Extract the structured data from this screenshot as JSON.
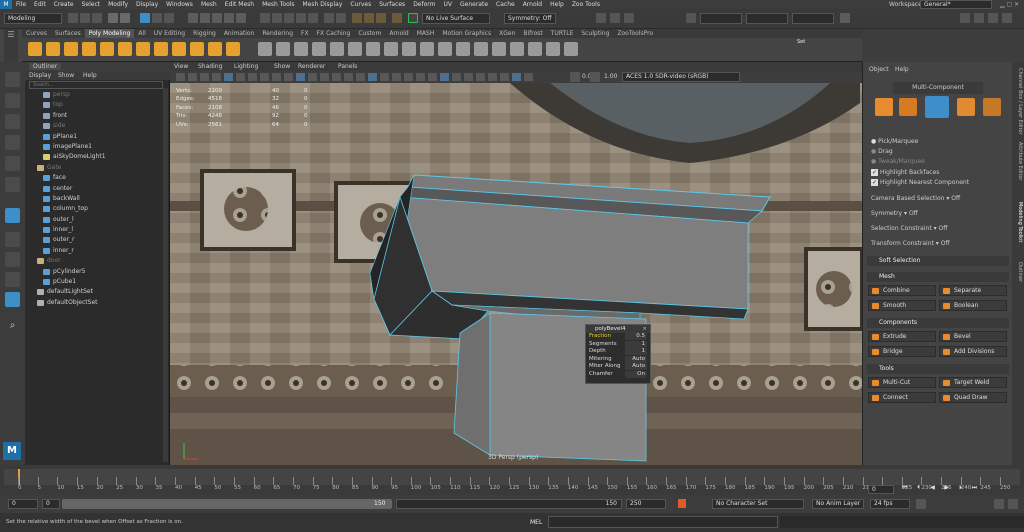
{
  "menubar": {
    "logo": "M",
    "items": [
      "File",
      "Edit",
      "Create",
      "Select",
      "Modify",
      "Display",
      "Windows",
      "Mesh",
      "Edit Mesh",
      "Mesh Tools",
      "Mesh Display",
      "Curves",
      "Surfaces",
      "Deform",
      "UV",
      "Generate",
      "Cache",
      "Arnold",
      "Help",
      "Zoo Tools"
    ],
    "workspace_label": "Workspace:",
    "workspace_value": "General*"
  },
  "status": {
    "mode": "Modeling",
    "live_surface": "No Live Surface",
    "symmetry": "Symmetry: Off",
    "set_label": "Set"
  },
  "shelf": {
    "tabs": [
      "Curves",
      "Surfaces",
      "Poly Modeling",
      "All",
      "UV Editing",
      "Rigging",
      "Animation",
      "Rendering",
      "FX",
      "FX Caching",
      "Custom",
      "Arnold",
      "MASH",
      "Motion Graphics",
      "XGen",
      "Bifrost",
      "TURTLE",
      "Sculpting",
      "ZooToolsPro"
    ],
    "active_tab": "Poly Modeling",
    "icon_colors": [
      "#e6a02e",
      "#e6a02e",
      "#e6a02e",
      "#e6a02e",
      "#e6a02e",
      "#e6a02e",
      "#e6a02e",
      "#e6a02e",
      "#e6a02e",
      "#e6a02e",
      "#e6a02e",
      "#e6a02e",
      "#9a9a9a",
      "#9a9a9a",
      "#9a9a9a",
      "#9a9a9a",
      "#9a9a9a",
      "#9a9a9a",
      "#9a9a9a",
      "#9a9a9a",
      "#9a9a9a",
      "#9a9a9a",
      "#9a9a9a",
      "#9a9a9a",
      "#9a9a9a",
      "#9a9a9a",
      "#9a9a9a",
      "#9a9a9a",
      "#9a9a9a",
      "#9a9a9a"
    ]
  },
  "outliner": {
    "title": "Outliner",
    "menu": [
      "Display",
      "Show",
      "Help"
    ],
    "search_placeholder": "Search...",
    "items": [
      {
        "name": "persp",
        "dim": true,
        "icon": "camera-icon"
      },
      {
        "name": "top",
        "dim": true,
        "icon": "camera-icon"
      },
      {
        "name": "front",
        "dim": false,
        "icon": "camera-icon"
      },
      {
        "name": "side",
        "dim": true,
        "icon": "camera-icon"
      },
      {
        "name": "pPlane1",
        "dim": false,
        "icon": "mesh-icon"
      },
      {
        "name": "imagePlane1",
        "dim": false,
        "icon": "mesh-icon"
      },
      {
        "name": "aiSkyDomeLight1",
        "dim": false,
        "icon": "light-icon"
      },
      {
        "name": "Gate",
        "dim": true,
        "icon": "group-icon"
      },
      {
        "name": "face",
        "dim": false,
        "icon": "mesh-icon"
      },
      {
        "name": "center",
        "dim": false,
        "icon": "mesh-icon"
      },
      {
        "name": "backWall",
        "dim": false,
        "icon": "mesh-icon"
      },
      {
        "name": "column_top",
        "dim": false,
        "icon": "mesh-icon"
      },
      {
        "name": "outer_l",
        "dim": false,
        "icon": "mesh-icon"
      },
      {
        "name": "inner_l",
        "dim": false,
        "icon": "mesh-icon"
      },
      {
        "name": "outer_r",
        "dim": false,
        "icon": "mesh-icon"
      },
      {
        "name": "inner_r",
        "dim": false,
        "icon": "mesh-icon"
      },
      {
        "name": "door",
        "dim": true,
        "icon": "group-icon"
      },
      {
        "name": "pCylinder5",
        "dim": false,
        "icon": "mesh-icon"
      },
      {
        "name": "pCube1",
        "dim": false,
        "icon": "mesh-icon"
      },
      {
        "name": "defaultLightSet",
        "dim": false,
        "icon": "set-icon"
      },
      {
        "name": "defaultObjectSet",
        "dim": false,
        "icon": "set-icon"
      }
    ]
  },
  "viewport": {
    "menu": [
      "View",
      "Shading",
      "Lighting",
      "Show",
      "Renderer",
      "Panels"
    ],
    "color_space": "ACES 1.0 SDR-video (sRGB)",
    "value_a": "0.00",
    "value_b": "1.00",
    "camera_label": "3D Persp (persp)",
    "hud": [
      {
        "label": "Verts:",
        "a": "2209",
        "b": "40",
        "c": "0"
      },
      {
        "label": "Edges:",
        "a": "4518",
        "b": "32",
        "c": "0"
      },
      {
        "label": "Faces:",
        "a": "2108",
        "b": "46",
        "c": "0"
      },
      {
        "label": "Tris:",
        "a": "4248",
        "b": "92",
        "c": "0"
      },
      {
        "label": "UVs:",
        "a": "2561",
        "b": "64",
        "c": "0"
      }
    ],
    "bevel": {
      "title": "polyBevel4",
      "rows": [
        {
          "label": "Fraction",
          "value": "0.5",
          "highlight": true
        },
        {
          "label": "Segments",
          "value": "1",
          "highlight": false
        },
        {
          "label": "Depth",
          "value": "1",
          "highlight": false
        },
        {
          "label": "Mitering",
          "value": "Auto",
          "highlight": false
        },
        {
          "label": "Miter Along",
          "value": "Auto",
          "highlight": false
        },
        {
          "label": "Chamfer",
          "value": "On",
          "highlight": false
        }
      ]
    }
  },
  "modeling_toolkit": {
    "menu": [
      "Object",
      "Help"
    ],
    "mode_label": "Multi-Component",
    "radio_options": [
      "Pick/Marquee",
      "Drag",
      "Tweak/Marquee"
    ],
    "checks": [
      "Highlight Backfaces",
      "Highlight Nearest Component"
    ],
    "camera_based": "Camera Based Selection",
    "camera_based_value": "Off",
    "symmetry": "Symmetry",
    "symmetry_value": "Off",
    "selection_constraint": "Selection Constraint",
    "selection_constraint_value": "Off",
    "transform_constraint": "Transform Constraint",
    "transform_constraint_value": "Off",
    "soft_selection": "Soft Selection",
    "sections": {
      "mesh": "Mesh",
      "components": "Components",
      "tools": "Tools"
    },
    "mesh_buttons": [
      "Combine",
      "Separate",
      "Smooth",
      "Boolean"
    ],
    "component_buttons": [
      "Extrude",
      "Bevel",
      "Bridge",
      "Add Divisions"
    ],
    "tool_buttons": [
      "Multi-Cut",
      "Target Weld",
      "Connect",
      "Quad Draw"
    ]
  },
  "side_tabs": [
    "Channel Box / Layer Editor",
    "Attribute Editor",
    "Modeling Toolkit",
    "Outliner"
  ],
  "timeline": {
    "ticks": [
      "0",
      "5",
      "10",
      "15",
      "20",
      "25",
      "30",
      "35",
      "40",
      "45",
      "50",
      "55",
      "60",
      "65",
      "70",
      "75",
      "80",
      "85",
      "90",
      "95",
      "100",
      "105",
      "110",
      "115",
      "120",
      "125",
      "130",
      "135",
      "140",
      "145",
      "150",
      "155",
      "160",
      "165",
      "170",
      "175",
      "180",
      "185",
      "190",
      "195",
      "200",
      "205",
      "210",
      "215",
      "220",
      "225",
      "230",
      "235",
      "240",
      "245",
      "250"
    ],
    "current_frame": "0",
    "range_start": "0",
    "range_inner_start": "0",
    "range_inner_end": "150",
    "range_end": "250",
    "character_set": "No Character Set",
    "anim_layer": "No Anim Layer",
    "fps": "24 fps"
  },
  "cmdline": {
    "help_text": "Set the relative width of the bevel when Offset as Fraction is on.",
    "lang": "MEL"
  },
  "colors": {
    "accent": "#3d8ec9",
    "orange": "#e88a2e",
    "bevel_highlight": "#f2d21f"
  }
}
